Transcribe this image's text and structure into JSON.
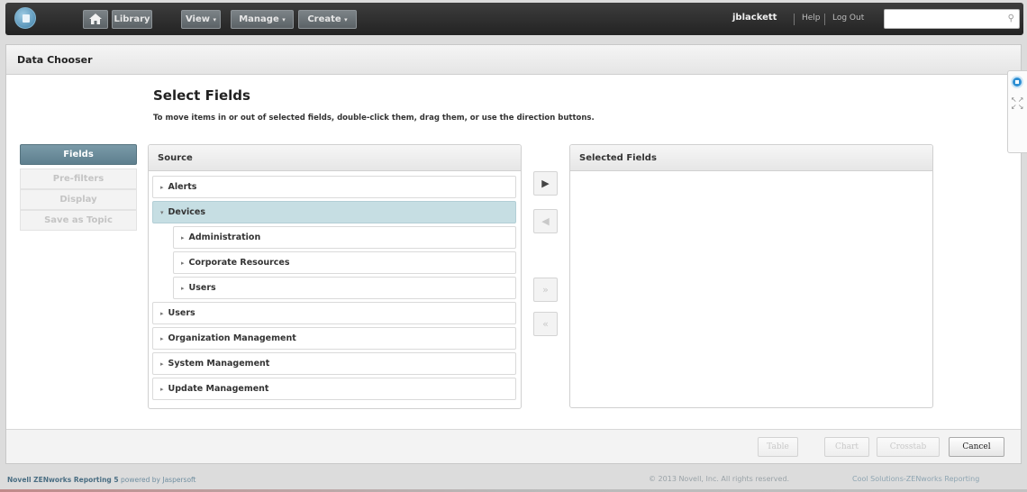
{
  "topbar": {
    "home_icon": "house-icon",
    "library_label": "Library",
    "view_label": "View",
    "manage_label": "Manage",
    "create_label": "Create",
    "dropdown_caret": "▾",
    "username": "jblackett",
    "help_label": "Help",
    "logout_label": "Log Out",
    "search_placeholder": "",
    "search_icon": "search-icon"
  },
  "panel": {
    "title": "Data Chooser",
    "heading": "Select Fields",
    "instructions": "To move items in or out of selected fields, double-click them, drag them, or use the direction buttons."
  },
  "sidenav": {
    "items": [
      {
        "label": "Fields",
        "active": true
      },
      {
        "label": "Pre-filters",
        "active": false
      },
      {
        "label": "Display",
        "active": false
      },
      {
        "label": "Save as Topic",
        "active": false
      }
    ]
  },
  "source": {
    "header": "Source",
    "nodes": [
      {
        "label": "Alerts",
        "arrow": "▸",
        "level": 0,
        "selected": false
      },
      {
        "label": "Devices",
        "arrow": "▾",
        "level": 0,
        "selected": true
      },
      {
        "label": "Administration",
        "arrow": "▸",
        "level": 1,
        "selected": false
      },
      {
        "label": "Corporate Resources",
        "arrow": "▸",
        "level": 1,
        "selected": false
      },
      {
        "label": "Users",
        "arrow": "▸",
        "level": 1,
        "selected": false
      },
      {
        "label": "Users",
        "arrow": "▸",
        "level": 0,
        "selected": false
      },
      {
        "label": "Organization Management",
        "arrow": "▸",
        "level": 0,
        "selected": false
      },
      {
        "label": "System Management",
        "arrow": "▸",
        "level": 0,
        "selected": false
      },
      {
        "label": "Update Management",
        "arrow": "▸",
        "level": 0,
        "selected": false
      }
    ]
  },
  "move_buttons": {
    "add": "▶",
    "remove": "◀",
    "add_all": "»",
    "remove_all": "«"
  },
  "selected": {
    "header": "Selected Fields"
  },
  "footer_buttons": {
    "table": "Table",
    "chart": "Chart",
    "crosstab": "Crosstab",
    "cancel": "Cancel"
  },
  "footer": {
    "product": "Novell ZENworks Reporting 5",
    "powered": " powered by Jaspersoft",
    "copyright": "© 2013 Novell, Inc. All rights reserved.",
    "cool_solutions": "Cool Solutions-ZENworks Reporting"
  }
}
